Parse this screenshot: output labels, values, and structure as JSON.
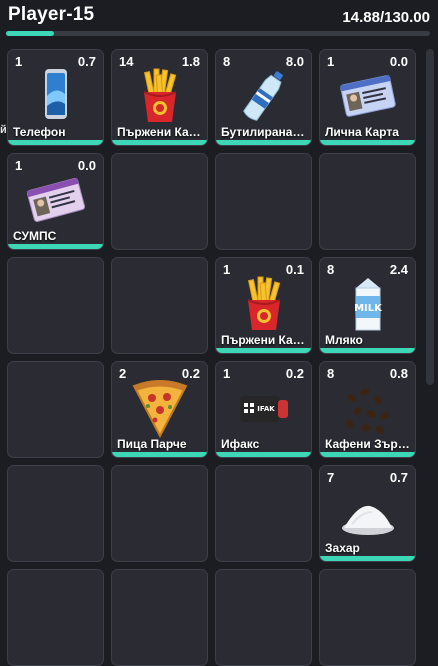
{
  "player": {
    "name": "Player-15",
    "weight": "14.88/130.00",
    "weight_fill": 0.114
  },
  "edge_text": "й",
  "slots": [
    {
      "qty": "1",
      "weight": "0.7",
      "label": "Телефон",
      "icon": "phone-icon",
      "durability": 1.0
    },
    {
      "qty": "14",
      "weight": "1.8",
      "label": "Пържени Картофи",
      "icon": "fries-icon",
      "durability": 1.0
    },
    {
      "qty": "8",
      "weight": "8.0",
      "label": "Бутилирана Вода",
      "icon": "water-bottle-icon",
      "durability": 1.0
    },
    {
      "qty": "1",
      "weight": "0.0",
      "label": "Лична Карта",
      "icon": "id-card-icon",
      "durability": 1.0
    },
    {
      "qty": "1",
      "weight": "0.0",
      "label": "СУМПС",
      "icon": "license-card-icon",
      "durability": 1.0
    },
    null,
    null,
    null,
    null,
    null,
    {
      "qty": "1",
      "weight": "0.1",
      "label": "Пържени Картофи",
      "icon": "fries-icon",
      "durability": 1.0
    },
    {
      "qty": "8",
      "weight": "2.4",
      "label": "Мляко",
      "icon": "milk-carton-icon",
      "durability": 1.0
    },
    null,
    {
      "qty": "2",
      "weight": "0.2",
      "label": "Пица Парче",
      "icon": "pizza-slice-icon",
      "durability": 1.0
    },
    {
      "qty": "1",
      "weight": "0.2",
      "label": "Ифакс",
      "icon": "ifak-kit-icon",
      "durability": 1.0
    },
    {
      "qty": "8",
      "weight": "0.8",
      "label": "Кафени Зърна",
      "icon": "coffee-beans-icon",
      "durability": 1.0
    },
    null,
    null,
    null,
    {
      "qty": "7",
      "weight": "0.7",
      "label": "Захар",
      "icon": "sugar-pile-icon",
      "durability": 1.0
    },
    null,
    null,
    null,
    null
  ],
  "colors": {
    "background": "#1c1d22",
    "slot": "#2b2c33",
    "accent": "#3dd6b6"
  }
}
